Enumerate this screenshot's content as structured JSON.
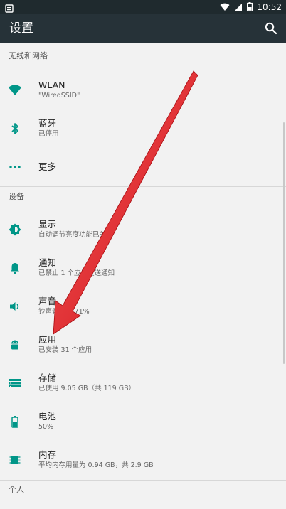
{
  "status_bar": {
    "time": "10:52"
  },
  "app_bar": {
    "title": "设置"
  },
  "sections": {
    "wireless": "无线和网络",
    "device": "设备",
    "personal": "个人"
  },
  "items": {
    "wlan": {
      "title": "WLAN",
      "summary": "\"WiredSSID\""
    },
    "bluetooth": {
      "title": "蓝牙",
      "summary": "已停用"
    },
    "more": {
      "title": "更多"
    },
    "display": {
      "title": "显示",
      "summary": "自动调节亮度功能已关闭"
    },
    "notifications": {
      "title": "通知",
      "summary": "已禁止 1 个应用发送通知"
    },
    "sound": {
      "title": "声音",
      "summary": "铃声音量为 71%"
    },
    "apps": {
      "title": "应用",
      "summary": "已安装 31 个应用"
    },
    "storage": {
      "title": "存储",
      "summary": "已使用 9.05 GB（共 119 GB）"
    },
    "battery": {
      "title": "电池",
      "summary": "50%"
    },
    "memory": {
      "title": "内存",
      "summary": "平均内存用量为 0.94 GB，共 2.9 GB"
    }
  },
  "colors": {
    "accent": "#009688",
    "app_bar": "#263238",
    "status_bar": "#1f2a2e",
    "annotation_arrow": "#e3161b"
  },
  "icons": {
    "status_left": "notification-icon",
    "wifi": "wifi-icon",
    "bluetooth": "bluetooth-icon",
    "more": "more-dots-icon",
    "display": "brightness-icon",
    "notifications": "bell-icon",
    "sound": "volume-icon",
    "apps": "android-icon",
    "storage": "storage-icon",
    "battery": "battery-icon",
    "memory": "memory-icon",
    "search": "search-icon"
  }
}
